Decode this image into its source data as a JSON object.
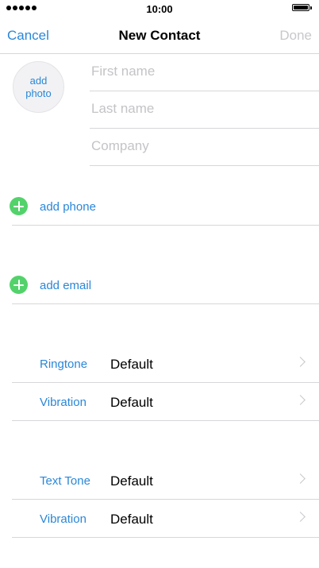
{
  "status_bar": {
    "time": "10:00"
  },
  "nav": {
    "cancel": "Cancel",
    "title": "New Contact",
    "done": "Done"
  },
  "photo": {
    "line1": "add",
    "line2": "photo"
  },
  "fields": {
    "first_name": {
      "placeholder": "First name",
      "value": ""
    },
    "last_name": {
      "placeholder": "Last name",
      "value": ""
    },
    "company": {
      "placeholder": "Company",
      "value": ""
    }
  },
  "add_phone": "add phone",
  "add_email": "add email",
  "call_settings": [
    {
      "label": "Ringtone",
      "value": "Default"
    },
    {
      "label": "Vibration",
      "value": "Default"
    }
  ],
  "text_settings": [
    {
      "label": "Text Tone",
      "value": "Default"
    },
    {
      "label": "Vibration",
      "value": "Default"
    }
  ]
}
